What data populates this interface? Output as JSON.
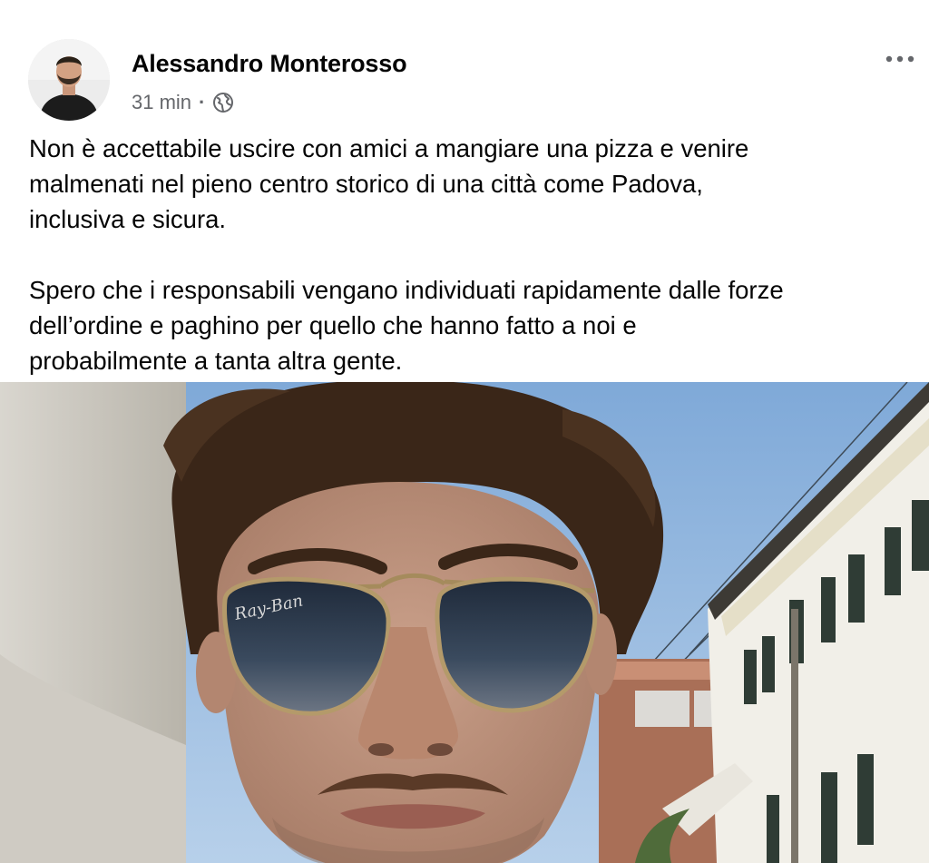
{
  "post": {
    "author": "Alessandro Monterosso",
    "time": "31 min",
    "separator": "·",
    "privacy_icon": "globe-icon",
    "more_icon": "more-options-icon",
    "paragraphs": [
      [
        "Non è accettabile uscire con amici a mangiare una pizza e venire",
        "malmenati nel pieno centro storico di una città come Padova,",
        "inclusiva e sicura."
      ],
      [
        "Spero che i responsabili vengano individuati rapidamente dalle forze",
        "dell’ordine e paghino per quello che hanno fatto a noi e",
        "probabilmente a tanta altra gente."
      ]
    ],
    "sunglasses_brand": "Ray-Ban"
  }
}
